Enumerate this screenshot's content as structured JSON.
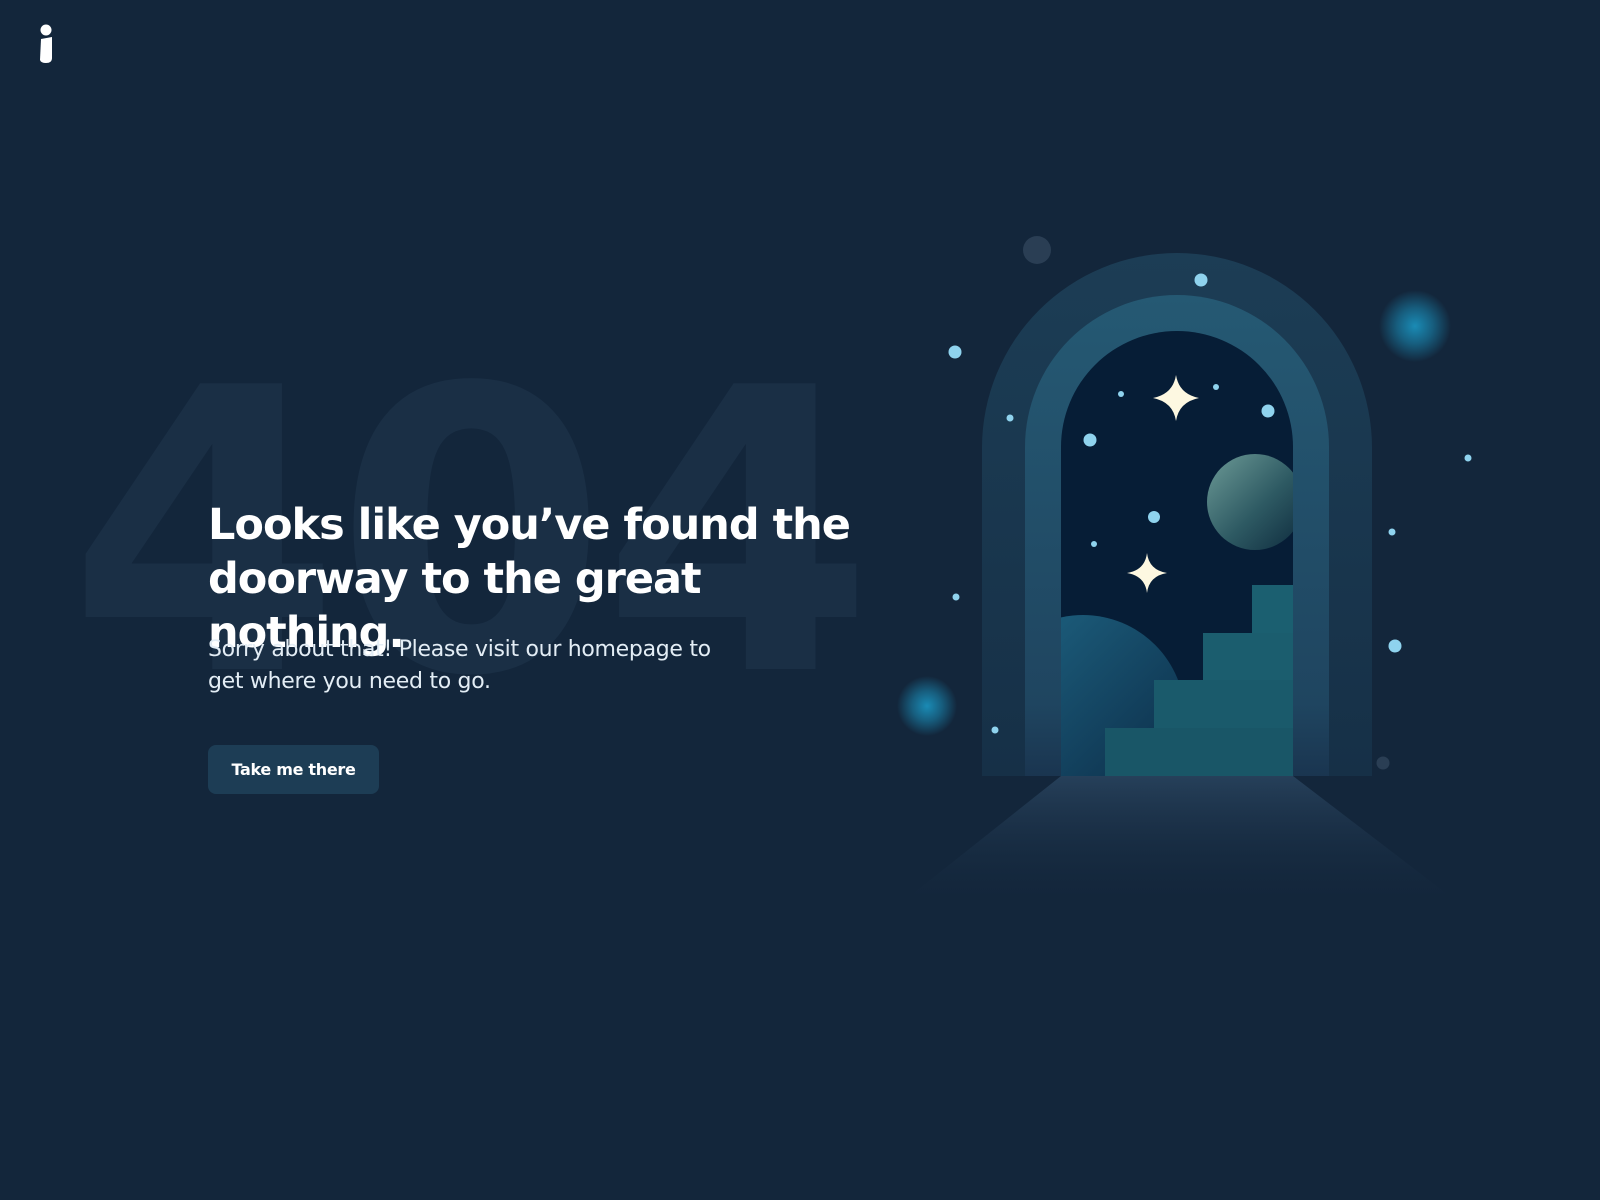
{
  "brand": {
    "logo_icon": "brand-i-logo-icon"
  },
  "background_code": "404",
  "main": {
    "headline": "Looks like you’ve found the doorway to the great nothing.",
    "subtext": "Sorry about that! Please visit our homepage to get where you need to go.",
    "cta_label": "Take me there"
  },
  "colors": {
    "background": "#13263b",
    "button": "#1d3d55",
    "star": "#fdf8e1",
    "dot": "#8fd3ee",
    "glow": "#1a8bb5"
  }
}
